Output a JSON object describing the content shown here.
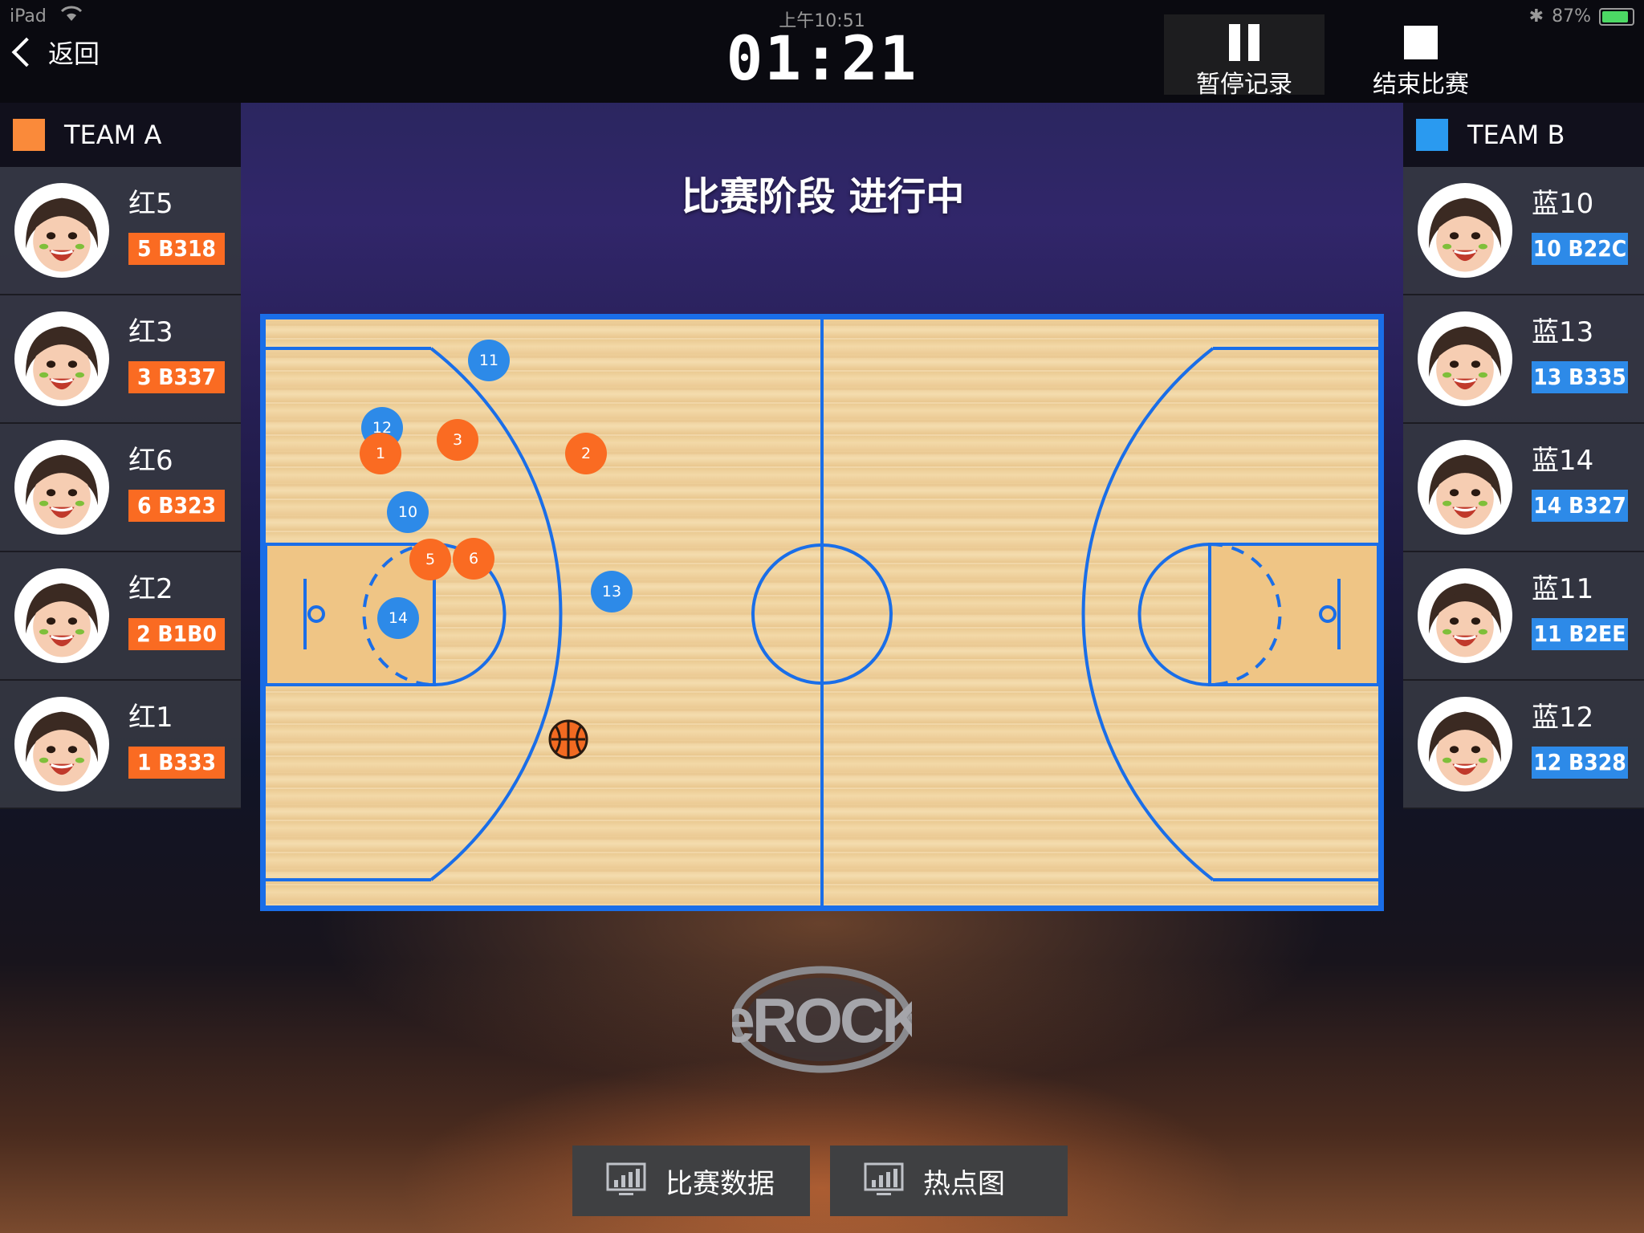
{
  "status_bar": {
    "carrier": "iPad",
    "time": "上午10:51",
    "battery": "87%"
  },
  "nav": {
    "back_label": "返回",
    "timer": "01:21",
    "pause_label": "暂停记录",
    "end_label": "结束比赛"
  },
  "phase_title": "比赛阶段 进行中",
  "colors": {
    "team_a": "#fa6b22",
    "team_b": "#2d8ae8",
    "court_line": "#1a6ee8"
  },
  "team_a": {
    "name": "TEAM A",
    "players": [
      {
        "name": "红5",
        "tag": "5 B318"
      },
      {
        "name": "红3",
        "tag": "3 B337"
      },
      {
        "name": "红6",
        "tag": "6 B323"
      },
      {
        "name": "红2",
        "tag": "2 B1B0"
      },
      {
        "name": "红1",
        "tag": "1 B333"
      }
    ]
  },
  "team_b": {
    "name": "TEAM B",
    "players": [
      {
        "name": "蓝10",
        "tag": "10 B22C"
      },
      {
        "name": "蓝13",
        "tag": "13 B335"
      },
      {
        "name": "蓝14",
        "tag": "14 B327"
      },
      {
        "name": "蓝11",
        "tag": "11 B2EE"
      },
      {
        "name": "蓝12",
        "tag": "12 B328"
      }
    ]
  },
  "court_markers": [
    {
      "label": "11",
      "team": "b"
    },
    {
      "label": "12",
      "team": "b"
    },
    {
      "label": "1",
      "team": "a"
    },
    {
      "label": "3",
      "team": "a"
    },
    {
      "label": "2",
      "team": "a"
    },
    {
      "label": "10",
      "team": "b"
    },
    {
      "label": "5",
      "team": "a"
    },
    {
      "label": "6",
      "team": "a"
    },
    {
      "label": "13",
      "team": "b"
    },
    {
      "label": "14",
      "team": "b"
    }
  ],
  "logo_text": "eROCK",
  "bottom_buttons": {
    "stats": "比赛数据",
    "heatmap": "热点图"
  }
}
